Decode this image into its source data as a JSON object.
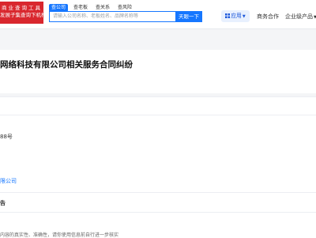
{
  "header": {
    "logo_line1": "商业查询工具",
    "logo_line2": "发展子集查询下机构",
    "tabs": [
      {
        "label": "查公司",
        "active": true
      },
      {
        "label": "查老板",
        "active": false
      },
      {
        "label": "查关系",
        "active": false
      },
      {
        "label": "查风险",
        "active": false
      }
    ],
    "search_placeholder": "请输入公司名称、老板姓名、品牌名称等",
    "search_button": "天眼一下",
    "app_label": "应用",
    "business_cooperation": "商务合作",
    "enterprise_products": "企业级产品"
  },
  "colors": {
    "brand_red": "#d9272e",
    "accent_blue": "#1677ff"
  },
  "main": {
    "title": "网络科技有限公司相关服务合同纠纷",
    "case_number_fragment": "88号",
    "company_link": "限公司",
    "notice_title": "告",
    "disclaimer": "内容的真实性、准确性，请你使用信息前自行进一步核实"
  }
}
